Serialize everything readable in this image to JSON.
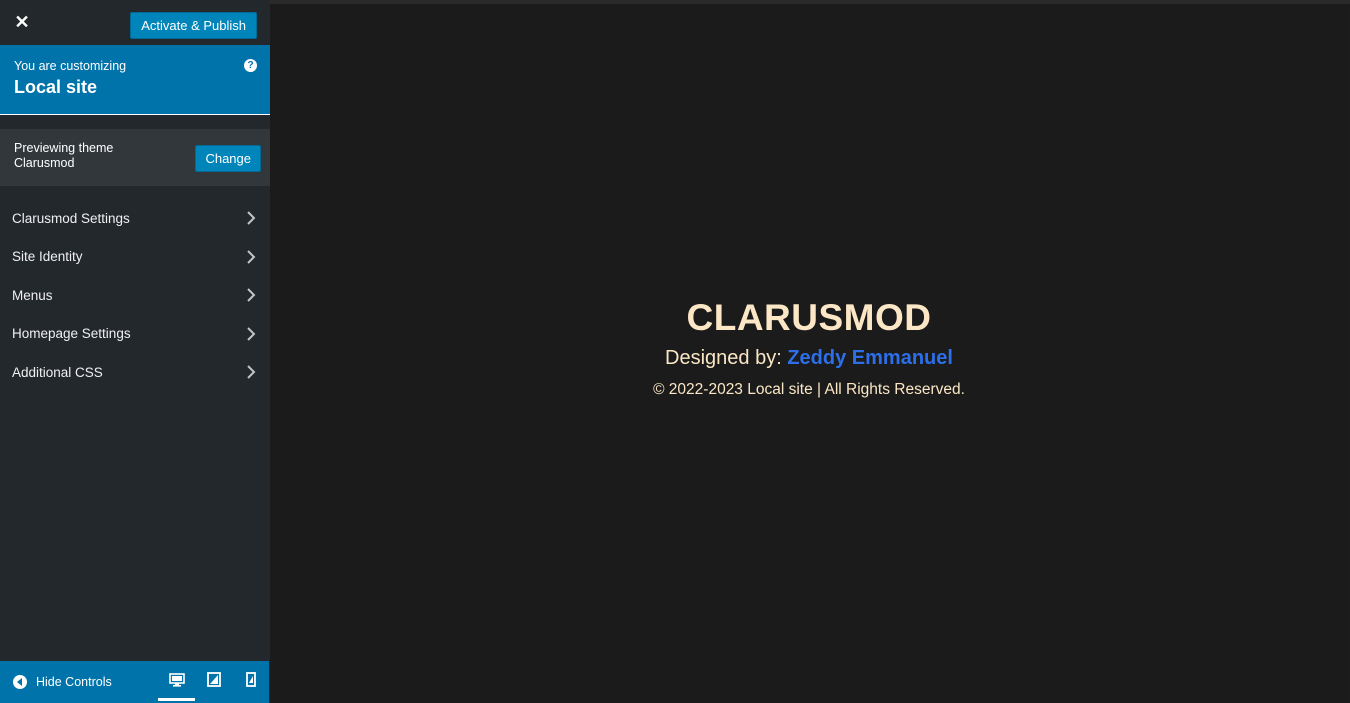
{
  "header": {
    "close_glyph": "✕",
    "publish_label": "Activate & Publish"
  },
  "customizing": {
    "label": "You are customizing",
    "site_name": "Local site",
    "help_glyph": "?"
  },
  "theme": {
    "label": "Previewing theme",
    "name": "Clarusmod",
    "change_label": "Change"
  },
  "menu": {
    "items": [
      {
        "label": "Clarusmod Settings"
      },
      {
        "label": "Site Identity"
      },
      {
        "label": "Menus"
      },
      {
        "label": "Homepage Settings"
      },
      {
        "label": "Additional CSS"
      }
    ]
  },
  "footer": {
    "hide_controls_label": "Hide Controls",
    "devices": [
      "desktop-icon",
      "tablet-icon",
      "mobile-icon"
    ],
    "active_device": "desktop"
  },
  "preview": {
    "title": "CLARUSMOD",
    "designed_by_prefix": "Designed by:",
    "designer_name": "Zeddy Emmanuel",
    "copyright": "© 2022-2023 Local site | All Rights Reserved."
  },
  "colors": {
    "accent": "#0073aa",
    "button": "#0085ba",
    "sidebar_bg": "#23282d",
    "preview_bg": "#1b1b1b",
    "title_color": "#fbe7c6",
    "link_color": "#2c6fe8"
  }
}
